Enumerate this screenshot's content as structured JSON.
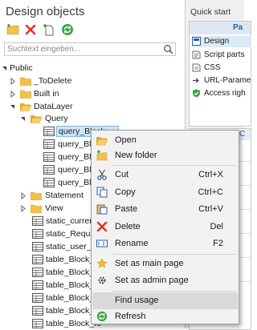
{
  "panel": {
    "title": "Design objects"
  },
  "search": {
    "placeholder": "Suchtext eingeben..."
  },
  "tree": {
    "public": "Public",
    "todelete": "_ToDelete",
    "builtin": "Built in",
    "datalayer": "DataLayer",
    "query": "Query",
    "query_items": [
      "query_Block_...",
      "query_Blo",
      "query_Blo",
      "query_Blo",
      "query_Blo"
    ],
    "statement": "Statement",
    "view": "View",
    "static_items": [
      "static_current",
      "static_Reques",
      "static_user_re"
    ],
    "table_items": [
      "table_Block_re",
      "table_Block_re",
      "table_Block_re",
      "table_Block_re",
      "table_Block_re",
      "table_Block_re",
      "table_Block_re"
    ]
  },
  "quick_start": {
    "title": "Quick start",
    "header": "Pa",
    "items": [
      "Design",
      "Script parts",
      "CSS",
      "URL-Parame",
      "Access righ"
    ]
  },
  "lower_panel": {
    "header": "C"
  },
  "context_menu": {
    "open": "Open",
    "new_folder": "New folder",
    "cut": "Cut",
    "cut_key": "Ctrl+X",
    "copy": "Copy",
    "copy_key": "Ctrl+C",
    "paste": "Paste",
    "paste_key": "Ctrl+V",
    "delete": "Delete",
    "delete_key": "Del",
    "rename": "Rename",
    "rename_key": "F2",
    "set_main": "Set as main page",
    "set_admin": "Set as admin page",
    "find_usage": "Find usage",
    "refresh": "Refresh"
  },
  "colors": {
    "accent": "#1e6fc2",
    "hover": "#d9d9d9",
    "selection": "#cde6f7"
  }
}
